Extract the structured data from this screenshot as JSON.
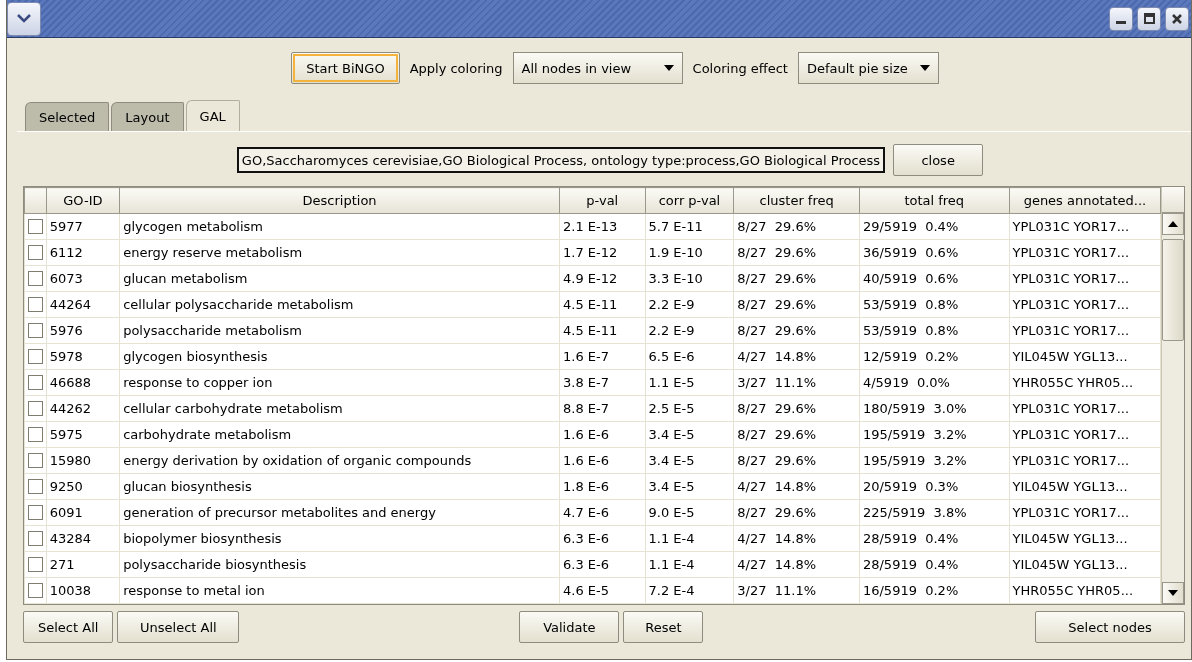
{
  "toolbar": {
    "start_button": {
      "label": "Start BiNGO",
      "focused": true
    },
    "apply_coloring": {
      "label": "Apply coloring",
      "value": "All nodes in view"
    },
    "coloring_effect": {
      "label": "Coloring effect",
      "value": "Default pie size"
    }
  },
  "tabs": [
    {
      "label": "Selected",
      "selected": false
    },
    {
      "label": "Layout",
      "selected": false
    },
    {
      "label": "GAL",
      "selected": true
    }
  ],
  "ontology_field": {
    "value": "GO,Saccharomyces cerevisiae,GO Biological Process, ontology type:process,GO Biological Process"
  },
  "close_button": "close",
  "table": {
    "columns": [
      "GO-ID",
      "Description",
      "p-val",
      "corr p-val",
      "cluster freq",
      "total freq",
      "genes annotated..."
    ],
    "rows": [
      {
        "checked": false,
        "cells": [
          "5977",
          "glycogen metabolism",
          "2.1 E-13",
          "5.7 E-11",
          "8/27  29.6%",
          "29/5919  0.4%",
          "YPL031C YOR17..."
        ]
      },
      {
        "checked": false,
        "cells": [
          "6112",
          "energy reserve metabolism",
          "1.7 E-12",
          "1.9 E-10",
          "8/27  29.6%",
          "36/5919  0.6%",
          "YPL031C YOR17..."
        ]
      },
      {
        "checked": false,
        "cells": [
          "6073",
          "glucan metabolism",
          "4.9 E-12",
          "3.3 E-10",
          "8/27  29.6%",
          "40/5919  0.6%",
          "YPL031C YOR17..."
        ]
      },
      {
        "checked": false,
        "cells": [
          "44264",
          "cellular polysaccharide metabolism",
          "4.5 E-11",
          "2.2 E-9",
          "8/27  29.6%",
          "53/5919  0.8%",
          "YPL031C YOR17..."
        ]
      },
      {
        "checked": false,
        "cells": [
          "5976",
          "polysaccharide metabolism",
          "4.5 E-11",
          "2.2 E-9",
          "8/27  29.6%",
          "53/5919  0.8%",
          "YPL031C YOR17..."
        ]
      },
      {
        "checked": false,
        "cells": [
          "5978",
          "glycogen biosynthesis",
          "1.6 E-7",
          "6.5 E-6",
          "4/27  14.8%",
          "12/5919  0.2%",
          "YIL045W YGL13..."
        ]
      },
      {
        "checked": false,
        "cells": [
          "46688",
          "response to copper ion",
          "3.8 E-7",
          "1.1 E-5",
          "3/27  11.1%",
          "4/5919  0.0%",
          "YHR055C YHR05..."
        ]
      },
      {
        "checked": false,
        "cells": [
          "44262",
          "cellular carbohydrate metabolism",
          "8.8 E-7",
          "2.5 E-5",
          "8/27  29.6%",
          "180/5919  3.0%",
          "YPL031C YOR17..."
        ]
      },
      {
        "checked": false,
        "cells": [
          "5975",
          "carbohydrate metabolism",
          "1.6 E-6",
          "3.4 E-5",
          "8/27  29.6%",
          "195/5919  3.2%",
          "YPL031C YOR17..."
        ]
      },
      {
        "checked": false,
        "cells": [
          "15980",
          "energy derivation by oxidation of organic compounds",
          "1.6 E-6",
          "3.4 E-5",
          "8/27  29.6%",
          "195/5919  3.2%",
          "YPL031C YOR17..."
        ]
      },
      {
        "checked": false,
        "cells": [
          "9250",
          "glucan biosynthesis",
          "1.8 E-6",
          "3.4 E-5",
          "4/27  14.8%",
          "20/5919  0.3%",
          "YIL045W YGL13..."
        ]
      },
      {
        "checked": false,
        "cells": [
          "6091",
          "generation of precursor metabolites and energy",
          "4.7 E-6",
          "9.0 E-5",
          "8/27  29.6%",
          "225/5919  3.8%",
          "YPL031C YOR17..."
        ]
      },
      {
        "checked": false,
        "cells": [
          "43284",
          "biopolymer biosynthesis",
          "6.3 E-6",
          "1.1 E-4",
          "4/27  14.8%",
          "28/5919  0.4%",
          "YIL045W YGL13..."
        ]
      },
      {
        "checked": false,
        "cells": [
          "271",
          "polysaccharide biosynthesis",
          "6.3 E-6",
          "1.1 E-4",
          "4/27  14.8%",
          "28/5919  0.4%",
          "YIL045W YGL13..."
        ]
      },
      {
        "checked": false,
        "cells": [
          "10038",
          "response to metal ion",
          "4.6 E-5",
          "7.2 E-4",
          "3/27  11.1%",
          "16/5919  0.2%",
          "YHR055C YHR05..."
        ]
      }
    ]
  },
  "bottom_buttons": {
    "left": [
      "Select All",
      "Unselect All"
    ],
    "middle": [
      "Validate",
      "Reset"
    ],
    "right": [
      "Select nodes"
    ]
  }
}
